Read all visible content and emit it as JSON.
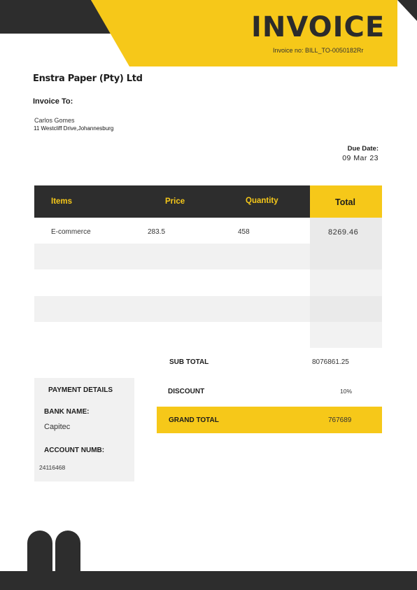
{
  "header": {
    "title": "INVOICE",
    "invoice_no": "Invoice no: BILL_TO-0050182Rr"
  },
  "company": {
    "name": "Enstra Paper (Pty) Ltd"
  },
  "bill_to": {
    "label": "Invoice To:",
    "name": "Carlos Gomes",
    "address": "11 Westcliff Drive,Johannesburg"
  },
  "due": {
    "label": "Due Date:",
    "date": "09 Mar 23"
  },
  "table": {
    "headers": {
      "items": "Items",
      "price": "Price",
      "quantity": "Quantity",
      "total": "Total"
    },
    "rows": [
      {
        "item": "E-commerce",
        "price": "283.5",
        "quantity": "458",
        "total": "8269.46"
      }
    ]
  },
  "summary": {
    "subtotal_label": "SUB TOTAL",
    "subtotal_value": "8076861.25",
    "discount_label": "DISCOUNT",
    "discount_value": "10%",
    "grand_total_label": "GRAND TOTAL",
    "grand_total_value": "767689"
  },
  "payment": {
    "title": "PAYMENT DETAILS",
    "bank_label": "BANK NAME:",
    "bank_value": "Capitec",
    "account_label": "ACCOUNT NUMB:",
    "account_value": "24116468"
  },
  "colors": {
    "accent": "#f6c819",
    "dark": "#2d2d2d",
    "row_gray": "#f1f1f1"
  }
}
